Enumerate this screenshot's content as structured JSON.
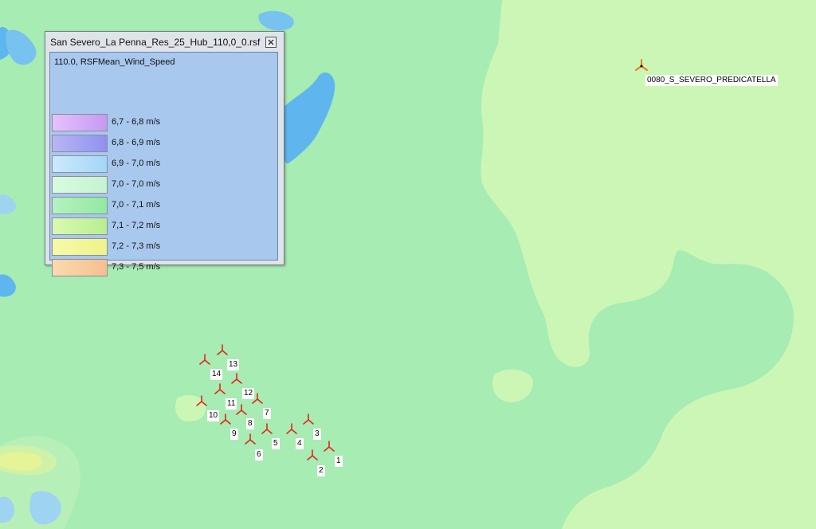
{
  "legend": {
    "title": "San Severo_La Penna_Res_25_Hub_110,0_0.rsf",
    "header": "110.0, RSFMean_Wind_Speed",
    "items": [
      {
        "label": "6,7 - 6,8 m/s",
        "color_start": "#e7c1fb",
        "color_end": "#c49af4"
      },
      {
        "label": "6,8 - 6,9 m/s",
        "color_start": "#b8b6f4",
        "color_end": "#8f91f0"
      },
      {
        "label": "6,9 - 7,0 m/s",
        "color_start": "#cbe9fc",
        "color_end": "#a4d6f6"
      },
      {
        "label": "7,0 - 7,0 m/s",
        "color_start": "#d9fbe0",
        "color_end": "#c4f3cf"
      },
      {
        "label": "7,0 - 7,1 m/s",
        "color_start": "#b5f2bf",
        "color_end": "#93e9a1"
      },
      {
        "label": "7,1 - 7,2 m/s",
        "color_start": "#d9f9b2",
        "color_end": "#b8ee91"
      },
      {
        "label": "7,2 - 7,3 m/s",
        "color_start": "#f7faa7",
        "color_end": "#eef38c"
      },
      {
        "label": "7,3 - 7,5 m/s",
        "color_start": "#fbd9b0",
        "color_end": "#f5c08f"
      }
    ]
  },
  "site": {
    "label": "0080_S_SEVERO_PREDICATELLA"
  },
  "turbines": [
    "1",
    "2",
    "3",
    "4",
    "5",
    "6",
    "7",
    "8",
    "9",
    "10",
    "11",
    "12",
    "13",
    "14"
  ],
  "colors": {
    "base_green": "#a6ecb3",
    "light_green": "#ccf6b5",
    "water_blue": "#5fb6ee",
    "light_blue": "#9fd3f2",
    "yellow": "#f0f68f",
    "turbine_red": "#e8231d",
    "site_marker": "#f07a1a"
  }
}
